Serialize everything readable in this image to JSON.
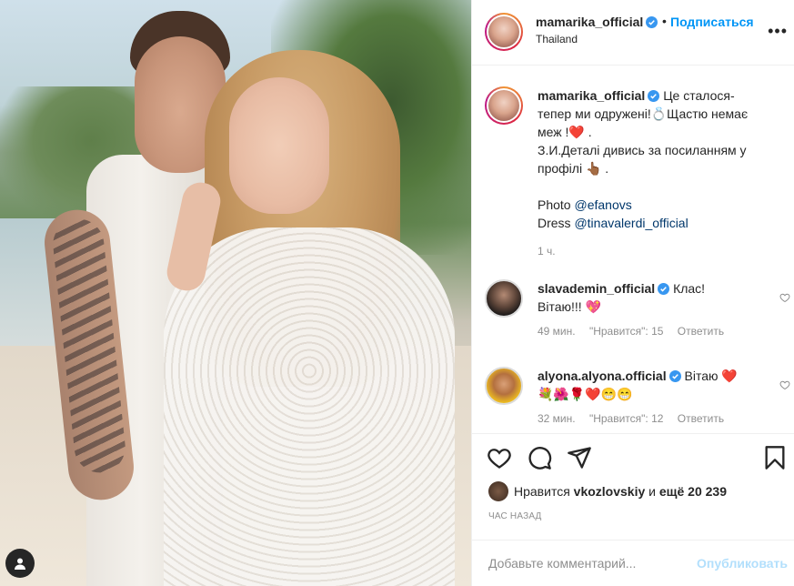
{
  "post": {
    "author": "mamarika_official",
    "follow_label": "Подписаться",
    "dot": "•",
    "location": "Thailand",
    "more_label": "•••"
  },
  "caption": {
    "author": "mamarika_official",
    "line1": "Це сталося-",
    "line2": "тепер ми одружені!💍Щастю немає",
    "line3": "меж !❤️ .",
    "line4": "З.И.Деталі дивись за посиланням у",
    "line5": "профілі 👆🏾 .",
    "photo_prefix": "Photo ",
    "photo_link": "@efanovs",
    "dress_prefix": "Dress ",
    "dress_link": "@tinavalerdi_official",
    "time": "1 ч."
  },
  "comments": [
    {
      "author": "slavademin_official",
      "text1": "Клас!",
      "text2": "Вітаю!!! 💖",
      "time": "49 мин.",
      "likes": "\"Нравится\": 15",
      "reply": "Ответить"
    },
    {
      "author": "alyona.alyona.official",
      "text1": "Вітаю ❤️",
      "text2": "💐🌺🌹❤️😁😁",
      "time": "32 мин.",
      "likes": "\"Нравится\": 12",
      "reply": "Ответить"
    }
  ],
  "likes": {
    "prefix": "Нравится ",
    "user": "vkozlovskiy",
    "suffix": " и ",
    "count": "ещё 20 239"
  },
  "time_ago": "ЧАС НАЗАД",
  "add_comment": {
    "placeholder": "Добавьте комментарий...",
    "post_label": "Опубликовать"
  },
  "colors": {
    "accent": "#0095f6",
    "verified": "#3897f0",
    "heart": "#ed4956",
    "muted": "#8e8e8e"
  }
}
